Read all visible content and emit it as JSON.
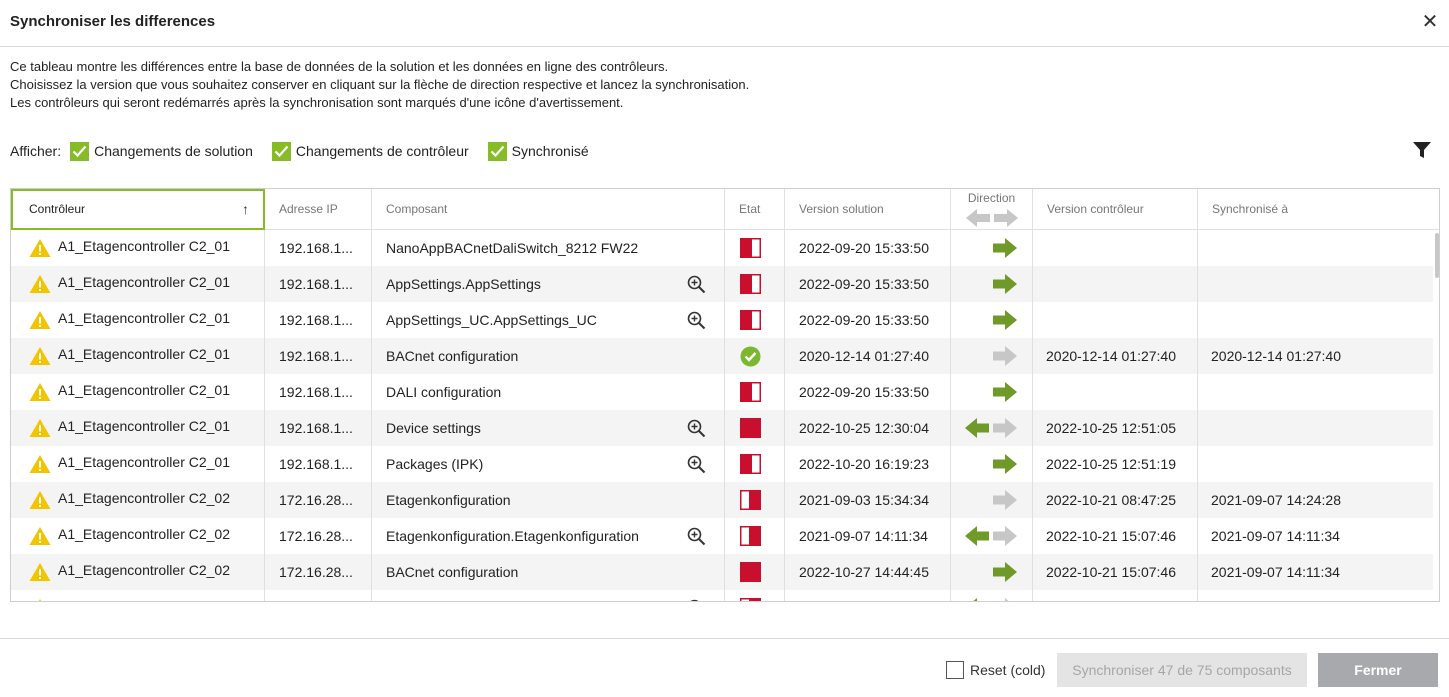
{
  "dialog": {
    "title": "Synchroniser les differences",
    "close_icon": "close-icon"
  },
  "description": [
    "Ce tableau montre les différences entre la base de données de la solution et les données en ligne des contrôleurs.",
    "Choisissez la version que vous souhaitez conserver en cliquant sur la flèche de direction respective et lancez la synchronisation.",
    "Les contrôleurs qui seront redémarrés après la synchronisation sont marqués d'une icône d'avertissement."
  ],
  "filters": {
    "label": "Afficher:",
    "options": [
      {
        "label": "Changements de solution",
        "checked": true
      },
      {
        "label": "Changements de contrôleur",
        "checked": true
      },
      {
        "label": "Synchronisé",
        "checked": true
      }
    ],
    "filter_icon": "funnel-icon"
  },
  "table": {
    "columns": {
      "controller": "Contrôleur",
      "ip": "Adresse IP",
      "component": "Composant",
      "state": "Etat",
      "version_solution": "Version solution",
      "direction": "Direction",
      "version_controller": "Version contrôleur",
      "synced_at": "Synchronisé à"
    },
    "sort": {
      "column": "controller",
      "order": "ascending"
    },
    "rows": [
      {
        "controller": "A1_Etagencontroller C2_01",
        "ip": "192.168.1...",
        "component": "NanoAppBACnetDaliSwitch_8212 FW22",
        "zoom": false,
        "state": "solution-changed",
        "version_solution": "2022-09-20 15:33:50",
        "direction": "right",
        "version_controller": "",
        "synced_at": ""
      },
      {
        "controller": "A1_Etagencontroller C2_01",
        "ip": "192.168.1...",
        "component": "AppSettings.AppSettings",
        "zoom": true,
        "state": "solution-changed",
        "version_solution": "2022-09-20 15:33:50",
        "direction": "right",
        "version_controller": "",
        "synced_at": ""
      },
      {
        "controller": "A1_Etagencontroller C2_01",
        "ip": "192.168.1...",
        "component": "AppSettings_UC.AppSettings_UC",
        "zoom": true,
        "state": "solution-changed",
        "version_solution": "2022-09-20 15:33:50",
        "direction": "right",
        "version_controller": "",
        "synced_at": ""
      },
      {
        "controller": "A1_Etagencontroller C2_01",
        "ip": "192.168.1...",
        "component": "BACnet configuration",
        "zoom": false,
        "state": "synced",
        "version_solution": "2020-12-14 01:27:40",
        "direction": "right-gray",
        "version_controller": "2020-12-14 01:27:40",
        "synced_at": "2020-12-14 01:27:40"
      },
      {
        "controller": "A1_Etagencontroller C2_01",
        "ip": "192.168.1...",
        "component": "DALI configuration",
        "zoom": false,
        "state": "solution-changed",
        "version_solution": "2022-09-20 15:33:50",
        "direction": "right",
        "version_controller": "",
        "synced_at": ""
      },
      {
        "controller": "A1_Etagencontroller C2_01",
        "ip": "192.168.1...",
        "component": "Device settings",
        "zoom": true,
        "state": "both-changed",
        "version_solution": "2022-10-25 12:30:04",
        "direction": "left",
        "version_controller": "2022-10-25 12:51:05",
        "synced_at": ""
      },
      {
        "controller": "A1_Etagencontroller C2_01",
        "ip": "192.168.1...",
        "component": "Packages (IPK)",
        "zoom": true,
        "state": "solution-changed",
        "version_solution": "2022-10-20 16:19:23",
        "direction": "right",
        "version_controller": "2022-10-25 12:51:19",
        "synced_at": ""
      },
      {
        "controller": "A1_Etagencontroller C2_02",
        "ip": "172.16.28...",
        "component": "Etagenkonfiguration",
        "zoom": false,
        "state": "controller-changed",
        "version_solution": "2021-09-03 15:34:34",
        "direction": "right-gray",
        "version_controller": "2022-10-21 08:47:25",
        "synced_at": "2021-09-07 14:24:28"
      },
      {
        "controller": "A1_Etagencontroller C2_02",
        "ip": "172.16.28...",
        "component": "Etagenkonfiguration.Etagenkonfiguration",
        "zoom": true,
        "state": "controller-changed",
        "version_solution": "2021-09-07 14:11:34",
        "direction": "left",
        "version_controller": "2022-10-21 15:07:46",
        "synced_at": "2021-09-07 14:11:34"
      },
      {
        "controller": "A1_Etagencontroller C2_02",
        "ip": "172.16.28...",
        "component": "BACnet configuration",
        "zoom": false,
        "state": "both-changed",
        "version_solution": "2022-10-27 14:44:45",
        "direction": "right",
        "version_controller": "2022-10-21 15:07:46",
        "synced_at": "2021-09-07 14:11:34"
      },
      {
        "controller": "",
        "ip": "",
        "component": "",
        "zoom": true,
        "state": "controller-changed",
        "version_solution": "",
        "direction": "left",
        "version_controller": "",
        "synced_at": ""
      }
    ]
  },
  "footer": {
    "reset_label": "Reset (cold)",
    "reset_checked": false,
    "sync_button": "Synchroniser 47 de 75 composants",
    "close_button": "Fermer"
  },
  "colors": {
    "accent_green": "#86bc25",
    "arrow_green": "#6f9a2a",
    "state_red": "#c8102e",
    "warning_yellow": "#f2c500",
    "ok_green": "#7cb82f"
  }
}
